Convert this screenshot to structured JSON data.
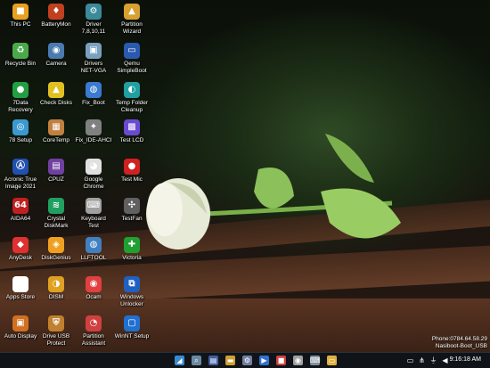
{
  "desktop_icons": [
    {
      "label": "This PC",
      "icon": "computer-icon",
      "color": "#e8a020"
    },
    {
      "label": "BatteryMon",
      "icon": "battery-icon",
      "color": "#c04020"
    },
    {
      "label": "Driver\n7,8,10,11",
      "icon": "gear-icon",
      "color": "#3a8a9a"
    },
    {
      "label": "Partition\nWizard",
      "icon": "partition-icon",
      "color": "#d8a030"
    },
    {
      "label": "Recycle Bin",
      "icon": "recycle-icon",
      "color": "#4aaa4a"
    },
    {
      "label": "Camera",
      "icon": "camera-icon",
      "color": "#4a7ab0"
    },
    {
      "label": "Drivers\nNET-VGA",
      "icon": "driver-icon",
      "color": "#7aa0c0"
    },
    {
      "label": "Qemu\nSimpleBoot",
      "icon": "monitor-icon",
      "color": "#2a5ab0"
    },
    {
      "label": "7Data\nRecovery",
      "icon": "recovery-icon",
      "color": "#20a040"
    },
    {
      "label": "Check Disks",
      "icon": "warning-icon",
      "color": "#e0c020"
    },
    {
      "label": "Fix_Boot",
      "icon": "globe-icon",
      "color": "#3a7ad0"
    },
    {
      "label": "Temp Folder\nCleanup",
      "icon": "cleanup-icon",
      "color": "#20a0a0"
    },
    {
      "label": "78 Setup",
      "icon": "setup-icon",
      "color": "#3a9ad0"
    },
    {
      "label": "CoreTemp",
      "icon": "chip-icon",
      "color": "#c08040"
    },
    {
      "label": "Fix_IDE-AHCI",
      "icon": "settings-icon",
      "color": "#808080"
    },
    {
      "label": "Test LCD",
      "icon": "grid-icon",
      "color": "#6a4ad0"
    },
    {
      "label": "Acronic True\nImage 2021",
      "icon": "acronis-icon",
      "color": "#2050b0"
    },
    {
      "label": "CPUZ",
      "icon": "cpu-icon",
      "color": "#7040a0"
    },
    {
      "label": "Google\nChrome",
      "icon": "chrome-icon",
      "color": "#e0e0e0"
    },
    {
      "label": "Test Mic",
      "icon": "microphone-icon",
      "color": "#d02020"
    },
    {
      "label": "AIDA64",
      "icon": "aida-icon",
      "color": "#c02020"
    },
    {
      "label": "Crystal\nDiskMark",
      "icon": "disk-icon",
      "color": "#20a060"
    },
    {
      "label": "Keyboard\nTest",
      "icon": "keyboard-icon",
      "color": "#a0a0a0"
    },
    {
      "label": "TestFan",
      "icon": "fan-icon",
      "color": "#606060"
    },
    {
      "label": "AnyDesk",
      "icon": "anydesk-icon",
      "color": "#e03030"
    },
    {
      "label": "DiskGenius",
      "icon": "diskgenius-icon",
      "color": "#f0a020"
    },
    {
      "label": "LLFTOOL",
      "icon": "tool-icon",
      "color": "#4080c0"
    },
    {
      "label": "Victoria",
      "icon": "plus-icon",
      "color": "#20a030"
    },
    {
      "label": "Apps Store",
      "icon": "store-icon",
      "color": "#ffffff"
    },
    {
      "label": "DISM",
      "icon": "dism-icon",
      "color": "#e0a020"
    },
    {
      "label": "Ocam",
      "icon": "ocam-icon",
      "color": "#e04040"
    },
    {
      "label": "Windows\nUnlocker",
      "icon": "unlock-icon",
      "color": "#2060c0"
    },
    {
      "label": "Auto Display",
      "icon": "display-icon",
      "color": "#d07020"
    },
    {
      "label": "Drive USB\nProtect",
      "icon": "shield-icon",
      "color": "#c08030"
    },
    {
      "label": "Partition\nAssistant",
      "icon": "pie-icon",
      "color": "#d04040"
    },
    {
      "label": "WinNT Setup",
      "icon": "setup-window-icon",
      "color": "#2070d0"
    }
  ],
  "glyphs": [
    "■",
    "♦",
    "⚙",
    "▲",
    "♻",
    "◉",
    "▣",
    "▭",
    "●",
    "▲",
    "◍",
    "◐",
    "◎",
    "▦",
    "✦",
    "▩",
    "Ⓐ",
    "▤",
    "◕",
    "●",
    "64",
    "≋",
    "⌨",
    "✣",
    "◆",
    "◈",
    "◍",
    "✚",
    "◧",
    "◑",
    "◉",
    "⧉",
    "▣",
    "⛨",
    "◔",
    "▢"
  ],
  "taskbar": {
    "items": [
      {
        "icon": "start-icon",
        "glyph": "◢",
        "color": "#3a8ad0"
      },
      {
        "icon": "search-icon",
        "glyph": "⌕",
        "color": "#6a8aa0"
      },
      {
        "icon": "taskview-icon",
        "glyph": "▤",
        "color": "#4060a0"
      },
      {
        "icon": "explorer-icon",
        "glyph": "▬",
        "color": "#d0a030"
      },
      {
        "icon": "settings-icon",
        "glyph": "⚙",
        "color": "#7080a0"
      },
      {
        "icon": "media-icon",
        "glyph": "▶",
        "color": "#3070d0"
      },
      {
        "icon": "app-icon",
        "glyph": "■",
        "color": "#d04040"
      },
      {
        "icon": "app2-icon",
        "glyph": "◉",
        "color": "#a0a0a0"
      },
      {
        "icon": "keyboard-icon",
        "glyph": "⌨",
        "color": "#8090a0"
      },
      {
        "icon": "folder-icon",
        "glyph": "▭",
        "color": "#e0b040"
      }
    ],
    "tray": [
      {
        "icon": "monitor-icon",
        "glyph": "▭"
      },
      {
        "icon": "network-icon",
        "glyph": "⋔"
      },
      {
        "icon": "usb-icon",
        "glyph": "⏚"
      },
      {
        "icon": "volume-icon",
        "glyph": "◀"
      }
    ],
    "clock": "9:16:18 AM"
  },
  "overlay": {
    "phone": "Phone:0784.64.58.29",
    "name": "Nasiboot-Boot_USB"
  }
}
